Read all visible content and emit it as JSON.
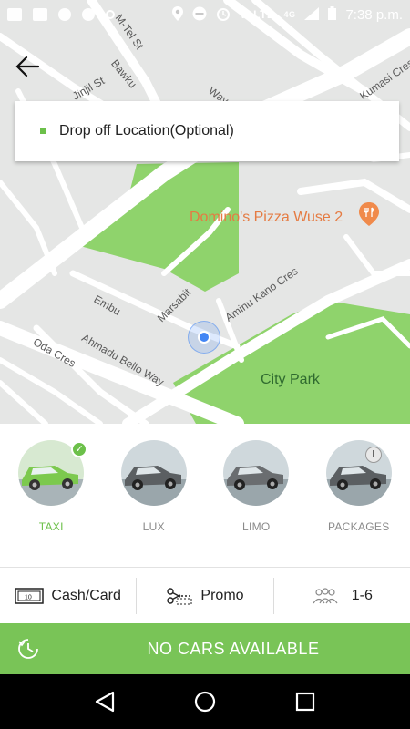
{
  "status_bar": {
    "network": "VoLTE",
    "signal": "4G",
    "time": "7:38 p.m."
  },
  "map": {
    "streets": [
      "M-Tel St",
      "Bawku",
      "Jinjil St",
      "Way",
      "Kumasi Cres",
      "Embu",
      "Marsabit",
      "Aminu Kano Cres",
      "Oda Cres",
      "Ahmadu Bello Way"
    ],
    "poi": "Domino's Pizza Wuse 2",
    "park": "City Park"
  },
  "search": {
    "placeholder": "Drop off Location(Optional)"
  },
  "vehicles": [
    {
      "label": "TAXI",
      "icon": "taxi-car-icon",
      "selected": true
    },
    {
      "label": "LUX",
      "icon": "lux-car-icon",
      "selected": false
    },
    {
      "label": "LIMO",
      "icon": "limo-car-icon",
      "selected": false
    },
    {
      "label": "PACKAGES",
      "icon": "package-car-icon",
      "selected": false
    }
  ],
  "options": {
    "payment": "Cash/Card",
    "promo": "Promo",
    "seats": "1-6"
  },
  "action": {
    "label": "NO CARS AVAILABLE"
  },
  "colors": {
    "accent": "#79c457",
    "park_green": "#8fd36c",
    "map_bg": "#e5e6e5"
  }
}
